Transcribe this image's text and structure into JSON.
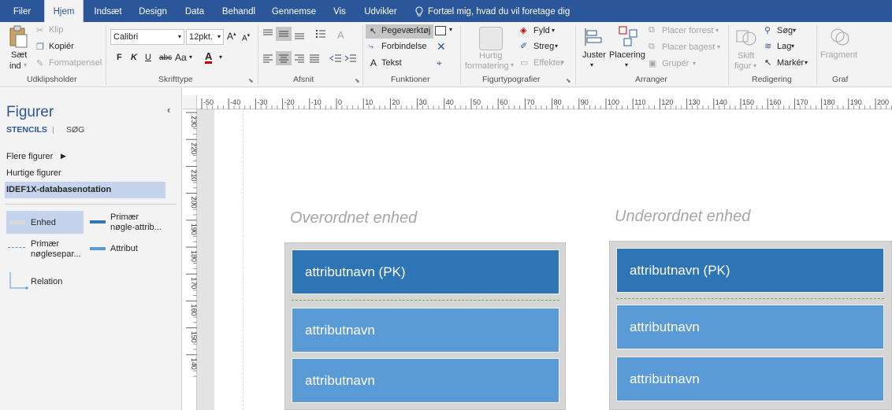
{
  "menu": {
    "tabs": [
      "Filer",
      "Hjem",
      "Indsæt",
      "Design",
      "Data",
      "Behandl",
      "Gennemse",
      "Vis",
      "Udvikler"
    ],
    "active": "Hjem",
    "tellme": "Fortæl mig, hvad du vil foretage dig"
  },
  "ribbon": {
    "clipboard": {
      "paste_line1": "Sæt",
      "paste_line2": "ind",
      "cut": "Klip",
      "copy": "Kopiér",
      "format_painter": "Formatpensel",
      "label": "Udklipsholder"
    },
    "font": {
      "family": "Calibri",
      "size": "12pkt.",
      "bold": "F",
      "italic": "K",
      "underline": "U",
      "strike": "abc",
      "case": "Aa",
      "color": "A",
      "label": "Skrifttype"
    },
    "paragraph": {
      "label": "Afsnit"
    },
    "tools": {
      "pointer": "Pegeværktøj",
      "connector": "Forbindelse",
      "text": "Tekst",
      "label": "Funktioner"
    },
    "shape_styles": {
      "quick_line1": "Hurtig",
      "quick_line2": "formatering",
      "fill": "Fyld",
      "line": "Streg",
      "effects": "Effekter",
      "label": "Figurtypografier"
    },
    "arrange": {
      "align": "Juster",
      "position": "Placering",
      "bring_front": "Placer forrest",
      "send_back": "Placer bagest",
      "group": "Grupér",
      "label": "Arranger"
    },
    "editing": {
      "change_line1": "Skift",
      "change_line2": "figur",
      "find": "Søg",
      "layers": "Lag",
      "select": "Markér",
      "label": "Redigering"
    },
    "graph": {
      "fragment": "Fragment",
      "label": "Graf"
    }
  },
  "shapes_panel": {
    "title": "Figurer",
    "tab_stencils": "STENCILS",
    "tab_search": "SØG",
    "more_shapes": "Flere figurer",
    "quick_shapes": "Hurtige figurer",
    "active_stencil": "IDEF1X-databasenotation",
    "items": [
      {
        "line1": "Enhed",
        "line2": ""
      },
      {
        "line1": "Primær",
        "line2": "nøgle-attrib..."
      },
      {
        "line1": "Primær",
        "line2": "nøglesepar..."
      },
      {
        "line1": "Attribut",
        "line2": ""
      },
      {
        "line1": "Relation",
        "line2": ""
      }
    ]
  },
  "ruler": {
    "horizontal": [
      "-50",
      "-40",
      "-30",
      "-20",
      "-10",
      "0",
      "10",
      "20",
      "30",
      "40",
      "50",
      "60",
      "70",
      "80",
      "90",
      "100",
      "110",
      "120",
      "130",
      "140",
      "150",
      "160",
      "170",
      "180",
      "190",
      "200"
    ],
    "vertical": [
      "230",
      "220",
      "210",
      "200",
      "190",
      "180",
      "170",
      "160",
      "150",
      "140"
    ]
  },
  "canvas": {
    "parent": {
      "heading": "Overordnet enhed",
      "pk": "attributnavn (PK)",
      "attrs": [
        "attributnavn",
        "attributnavn"
      ]
    },
    "child": {
      "heading": "Underordnet enhed",
      "pk": "attributnavn (PK)",
      "attrs": [
        "attributnavn",
        "attributnavn"
      ]
    }
  },
  "colors": {
    "accent": "#2b579a",
    "pk_fill": "#2e75b6",
    "attr_fill": "#5b9bd5",
    "entity_bg": "#d6d6d6"
  }
}
